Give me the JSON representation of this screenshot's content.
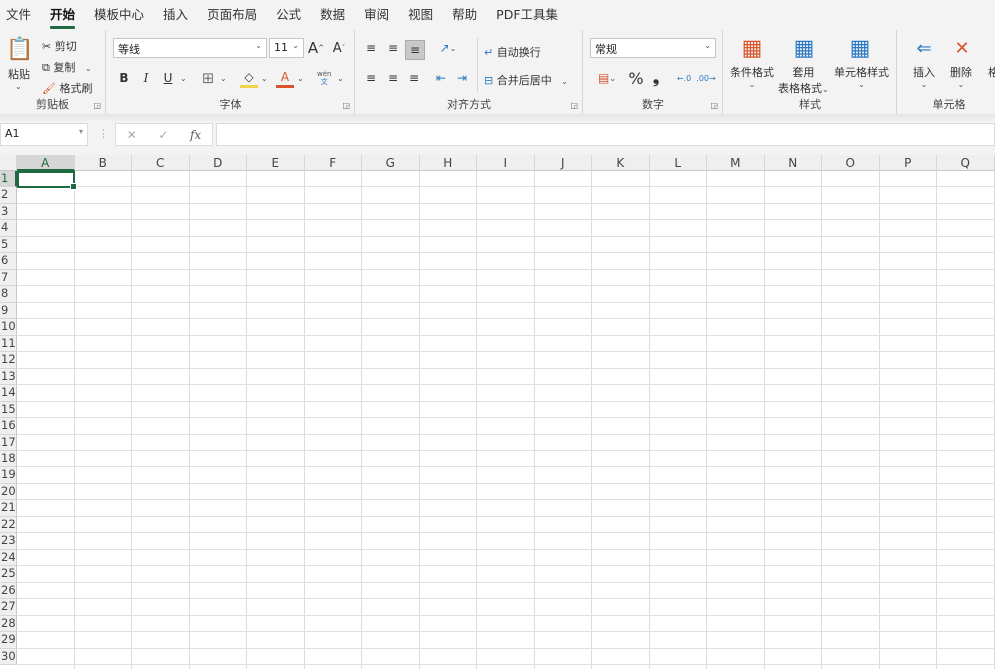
{
  "menu": [
    "文件",
    "开始",
    "模板中心",
    "插入",
    "页面布局",
    "公式",
    "数据",
    "审阅",
    "视图",
    "帮助",
    "PDF工具集"
  ],
  "active_menu": "开始",
  "clipboard": {
    "paste": "粘贴",
    "cut": "剪切",
    "copy": "复制",
    "format_painter": "格式刷",
    "label": "剪贴板"
  },
  "font": {
    "name": "等线",
    "size": "11",
    "label": "字体",
    "bold": "B",
    "italic": "I",
    "underline": "U",
    "phonetic": "wén",
    "phonetic2": "文",
    "font_color_letter": "A"
  },
  "alignment": {
    "wrap": "自动换行",
    "merge": "合并后居中",
    "label": "对齐方式"
  },
  "number": {
    "format": "常规",
    "percent": "%",
    "comma": "❟",
    "label": "数字"
  },
  "styles": {
    "conditional": "条件格式",
    "table1": "套用",
    "table2": "表格格式",
    "cell_styles": "单元格样式",
    "label": "样式"
  },
  "cells": {
    "insert": "插入",
    "delete": "删除",
    "format": "格",
    "label": "单元格"
  },
  "formula_bar": {
    "name_box": "A1",
    "cancel": "✕",
    "enter": "✓",
    "fx": "fx",
    "value": ""
  },
  "sheet": {
    "columns": [
      "A",
      "B",
      "C",
      "D",
      "E",
      "F",
      "G",
      "H",
      "I",
      "J",
      "K",
      "L",
      "M",
      "N",
      "O",
      "P",
      "Q"
    ],
    "rows": [
      "1",
      "2",
      "3",
      "4",
      "5",
      "6",
      "7",
      "8",
      "9",
      "10",
      "11",
      "12",
      "13",
      "14",
      "15",
      "16",
      "17",
      "18",
      "19",
      "20",
      "21",
      "22",
      "23",
      "24",
      "25",
      "26",
      "27",
      "28",
      "29",
      "30"
    ],
    "active_cell": "A1"
  },
  "colors": {
    "accent": "#1e6b41",
    "highlight": "#f2d44b",
    "font_color": "#d9532c"
  }
}
